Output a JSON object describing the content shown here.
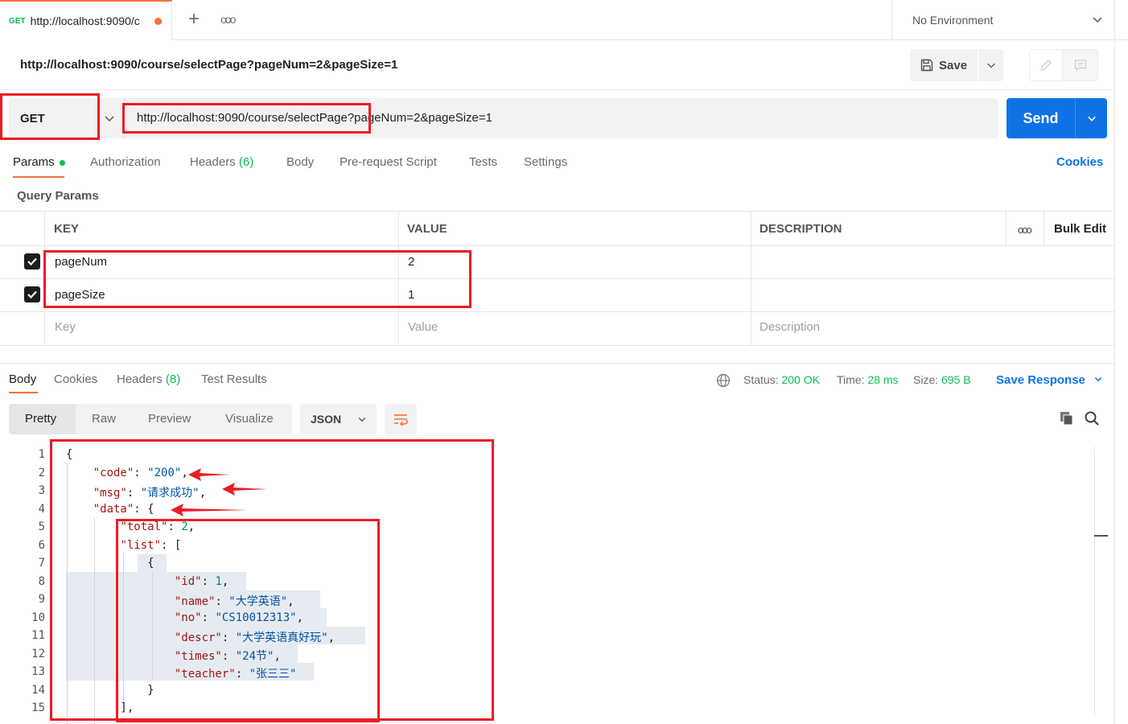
{
  "tab": {
    "method": "GET",
    "title": "http://localhost:9090/c"
  },
  "environment": "No Environment",
  "request": {
    "title": "http://localhost:9090/course/selectPage?pageNum=2&pageSize=1",
    "method": "GET",
    "url": "http://localhost:9090/course/selectPage?pageNum=2&pageSize=1",
    "save_label": "Save",
    "send_label": "Send"
  },
  "request_tabs": {
    "params": "Params",
    "authorization": "Authorization",
    "headers": "Headers",
    "headers_count": "(6)",
    "body": "Body",
    "pre_request": "Pre-request Script",
    "tests": "Tests",
    "settings": "Settings",
    "cookies": "Cookies"
  },
  "query_params": {
    "title": "Query Params",
    "headers": {
      "key": "KEY",
      "value": "VALUE",
      "description": "DESCRIPTION",
      "bulk_edit": "Bulk Edit"
    },
    "rows": [
      {
        "key": "pageNum",
        "value": "2",
        "checked": true
      },
      {
        "key": "pageSize",
        "value": "1",
        "checked": true
      }
    ],
    "placeholder": {
      "key": "Key",
      "value": "Value",
      "description": "Description"
    }
  },
  "response_tabs": {
    "body": "Body",
    "cookies": "Cookies",
    "headers": "Headers",
    "headers_count": "(8)",
    "test_results": "Test Results"
  },
  "response_status": {
    "status_label": "Status:",
    "status": "200 OK",
    "time_label": "Time:",
    "time": "28 ms",
    "size_label": "Size:",
    "size": "695 B",
    "save_response": "Save Response"
  },
  "view_tabs": {
    "pretty": "Pretty",
    "raw": "Raw",
    "preview": "Preview",
    "visualize": "Visualize",
    "format": "JSON"
  },
  "code_lines": {
    "line_numbers": [
      "1",
      "2",
      "3",
      "4",
      "5",
      "6",
      "7",
      "8",
      "9",
      "10",
      "11",
      "12",
      "13",
      "14",
      "15"
    ],
    "code_key": "\"code\"",
    "code_val": "\"200\"",
    "msg_key": "\"msg\"",
    "msg_val": "\"请求成功\"",
    "data_key": "\"data\"",
    "total_key": "\"total\"",
    "total_val": "2",
    "list_key": "\"list\"",
    "id_key": "\"id\"",
    "id_val": "1",
    "name_key": "\"name\"",
    "name_val": "\"大学英语\"",
    "no_key": "\"no\"",
    "no_val": "\"CS10012313\"",
    "descr_key": "\"descr\"",
    "descr_val": "\"大学英语真好玩\"",
    "times_key": "\"times\"",
    "times_val": "\"24节\"",
    "teacher_key": "\"teacher\"",
    "teacher_val": "\"张三三\""
  },
  "colors": {
    "accent_orange": "#ff6c37",
    "send_blue": "#0e72e6",
    "success_green": "#0cbb52",
    "annotation_red": "#ec1c24"
  }
}
